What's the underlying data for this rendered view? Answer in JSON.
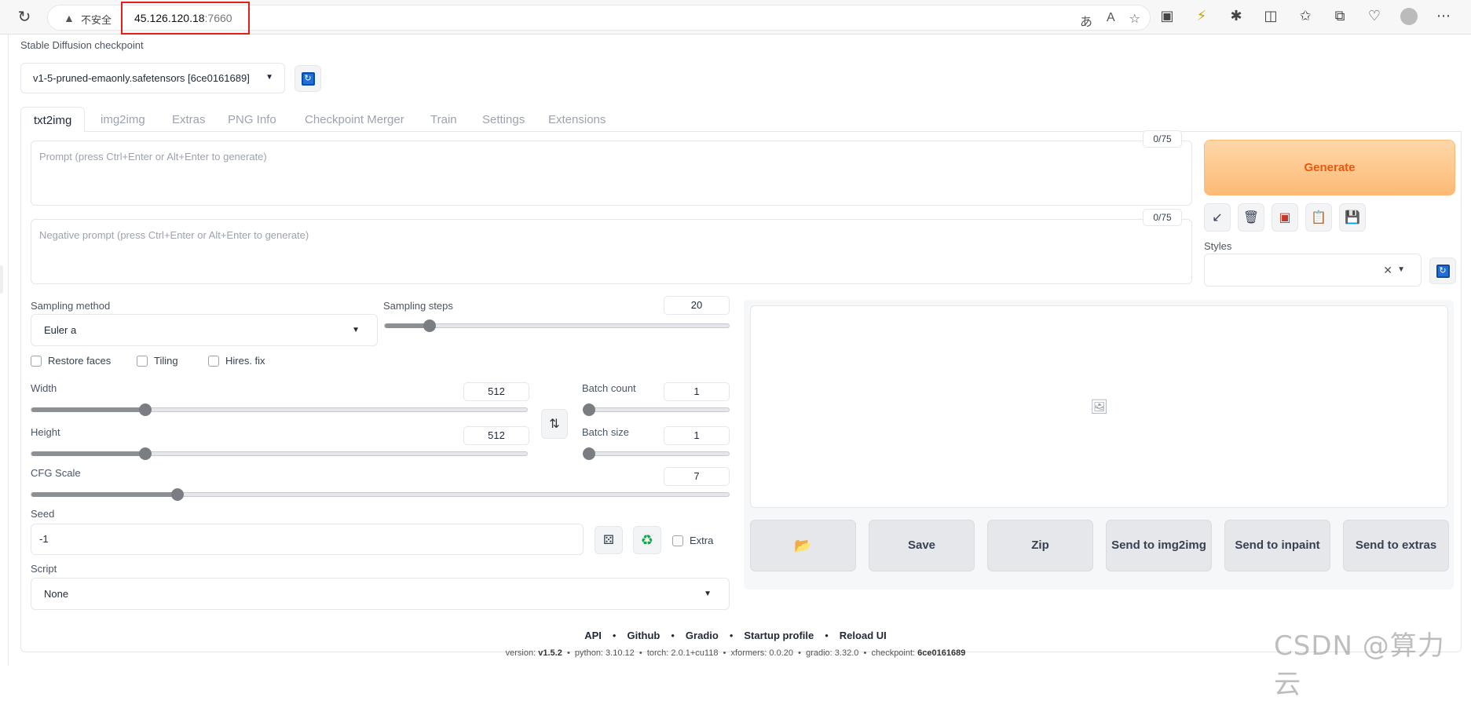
{
  "browser": {
    "insecure_label": "不安全",
    "url_host": "45.126.120.18",
    "url_port": ":7660"
  },
  "checkpoint": {
    "label": "Stable Diffusion checkpoint",
    "value": "v1-5-pruned-emaonly.safetensors [6ce0161689]"
  },
  "tabs": [
    "txt2img",
    "img2img",
    "Extras",
    "PNG Info",
    "Checkpoint Merger",
    "Train",
    "Settings",
    "Extensions"
  ],
  "prompt": {
    "placeholder": "Prompt (press Ctrl+Enter or Alt+Enter to generate)",
    "counter": "0/75"
  },
  "negative_prompt": {
    "placeholder": "Negative prompt (press Ctrl+Enter or Alt+Enter to generate)",
    "counter": "0/75"
  },
  "generate_label": "Generate",
  "styles_label": "Styles",
  "sampling_method": {
    "label": "Sampling method",
    "value": "Euler a"
  },
  "sampling_steps": {
    "label": "Sampling steps",
    "value": "20",
    "fraction": 0.13
  },
  "checkboxes": {
    "restore_faces": "Restore faces",
    "tiling": "Tiling",
    "hires_fix": "Hires. fix"
  },
  "width": {
    "label": "Width",
    "value": "512",
    "fraction": 0.23
  },
  "height": {
    "label": "Height",
    "value": "512",
    "fraction": 0.23
  },
  "batch_count": {
    "label": "Batch count",
    "value": "1",
    "fraction": 0.0
  },
  "batch_size": {
    "label": "Batch size",
    "value": "1",
    "fraction": 0.0
  },
  "cfg_scale": {
    "label": "CFG Scale",
    "value": "7",
    "fraction": 0.21
  },
  "seed": {
    "label": "Seed",
    "value": "-1",
    "extra_label": "Extra"
  },
  "script": {
    "label": "Script",
    "value": "None"
  },
  "actions": {
    "save": "Save",
    "zip": "Zip",
    "send_img2img": "Send to img2img",
    "send_inpaint": "Send to inpaint",
    "send_extras": "Send to extras"
  },
  "footer": {
    "links": [
      "API",
      "Github",
      "Gradio",
      "Startup profile",
      "Reload UI"
    ],
    "version_label": "version:",
    "version": "v1.5.2",
    "python": "python: 3.10.12",
    "torch": "torch: 2.0.1+cu118",
    "xformers": "xformers: 0.0.20",
    "gradio": "gradio: 3.32.0",
    "checkpoint_label": "checkpoint:",
    "checkpoint": "6ce0161689"
  },
  "watermark": "CSDN @算力云"
}
